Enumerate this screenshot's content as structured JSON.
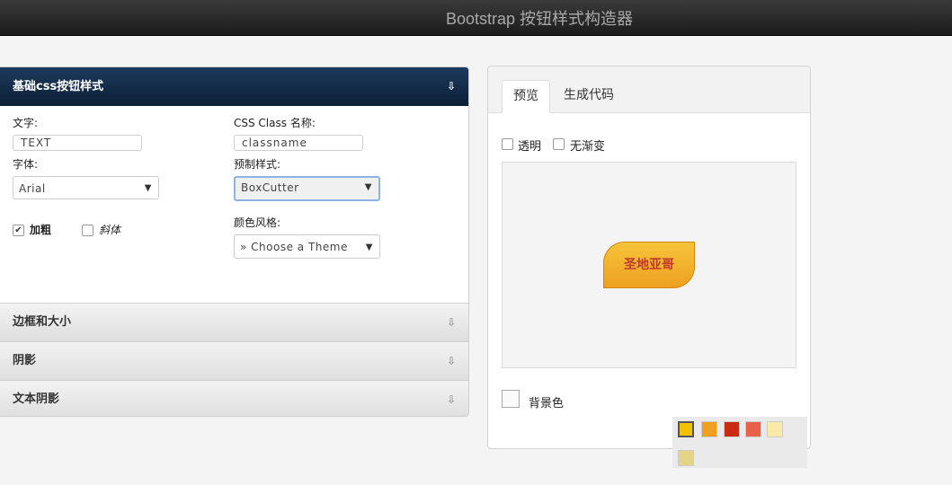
{
  "header": {
    "title": "Bootstrap 按钮样式构造器"
  },
  "left": {
    "section_basic": {
      "title": "基础css按钮样式",
      "arrow": "⇩",
      "text_label": "文字:",
      "text_value": "TEXT",
      "class_label": "CSS Class 名称:",
      "class_value": "classname",
      "font_label": "字体:",
      "font_value": "Arial",
      "preset_label": "预制样式:",
      "preset_value": "BoxCutter",
      "bold_label": "加粗",
      "italic_label": "斜体",
      "theme_label": "颜色风格:",
      "theme_value": "» Choose a Theme"
    },
    "sections": [
      {
        "title": "边框和大小",
        "arrow": "⇩"
      },
      {
        "title": "阴影",
        "arrow": "⇩"
      },
      {
        "title": "文本阴影",
        "arrow": "⇩"
      }
    ]
  },
  "right": {
    "tabs": [
      "预览",
      "生成代码"
    ],
    "transparent_label": "透明",
    "no_gradient_label": "无渐变",
    "button_text": "圣地亚哥",
    "bg_label": "背景色",
    "palette": [
      "#f2c200",
      "#f0a020",
      "#cc2a10",
      "#e8604a",
      "#fbe9a8",
      "#e4d488"
    ]
  },
  "caret": "▼"
}
